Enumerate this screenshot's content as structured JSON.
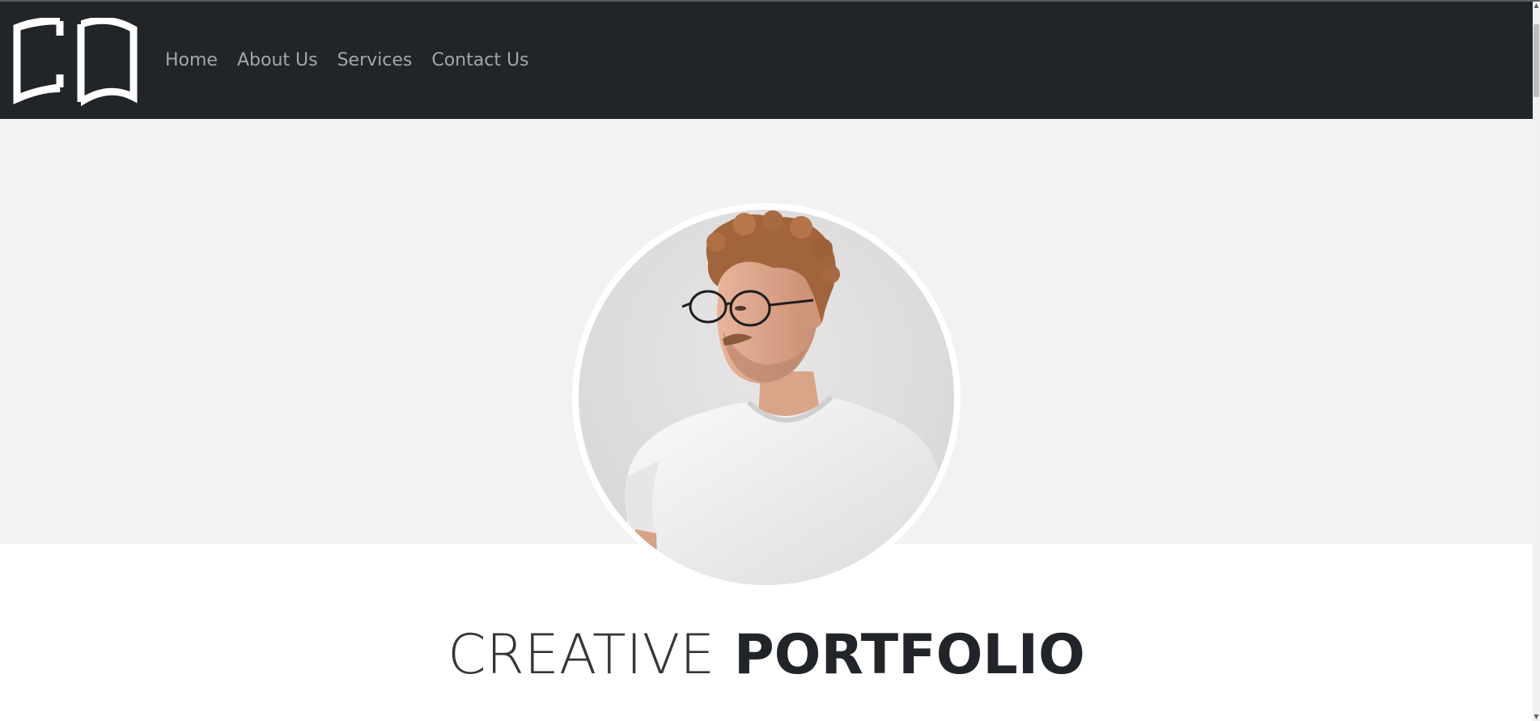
{
  "navbar": {
    "logo": {
      "icon": "open-book-logo-icon"
    },
    "links": [
      {
        "label": "Home"
      },
      {
        "label": "About Us"
      },
      {
        "label": "Services"
      },
      {
        "label": "Contact Us"
      }
    ]
  },
  "hero": {
    "portrait": {
      "subject": "portrait-photo"
    }
  },
  "headline": {
    "light": "CREATIVE",
    "bold": "PORTFOLIO"
  },
  "colors": {
    "navbar_bg": "#212529",
    "nav_link": "#a3a6aa",
    "hero_bg": "#f2f2f2",
    "headline": "#212529"
  }
}
